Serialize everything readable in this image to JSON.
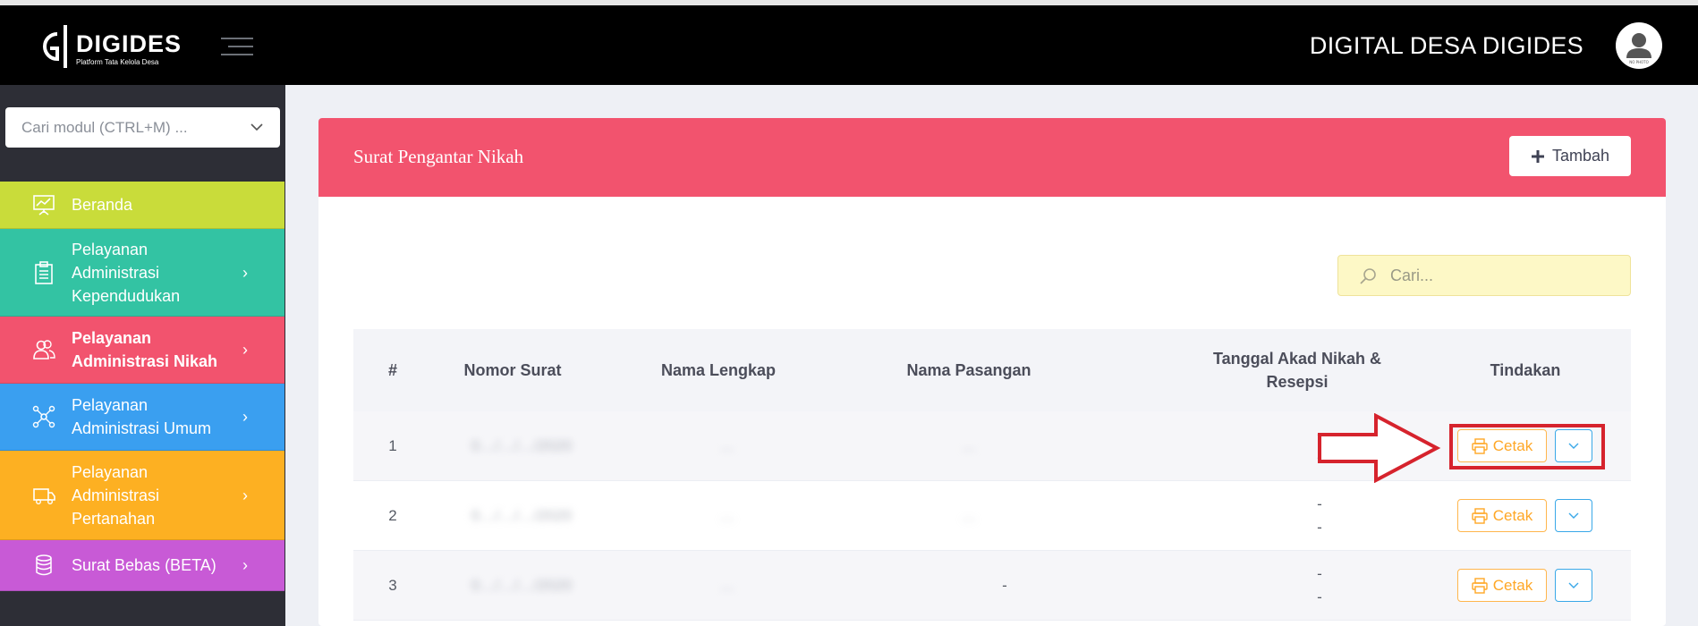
{
  "header": {
    "logo_name": "DIGIDES",
    "logo_tagline": "Platform Tata Kelola Desa",
    "app_title": "DIGITAL DESA DIGIDES",
    "avatar_text": "NO PHOTO"
  },
  "sidebar": {
    "module_search_placeholder": "Cari modul (CTRL+M) ...",
    "items": [
      {
        "label_lines": [
          "Beranda"
        ],
        "icon": "chart-presentation-icon",
        "color": "#c9dc3a",
        "has_arrow": false
      },
      {
        "label_lines": [
          "Pelayanan",
          "Administrasi",
          "Kependudukan"
        ],
        "icon": "clipboard-list-icon",
        "color": "#33c3a3",
        "has_arrow": true
      },
      {
        "label_lines": [
          "Pelayanan",
          "Administrasi Nikah"
        ],
        "icon": "users-icon",
        "color": "#f2536e",
        "has_arrow": true,
        "active": true
      },
      {
        "label_lines": [
          "Pelayanan",
          "Administrasi Umum"
        ],
        "icon": "network-icon",
        "color": "#3a9ff0",
        "has_arrow": true
      },
      {
        "label_lines": [
          "Pelayanan",
          "Administrasi",
          "Pertanahan"
        ],
        "icon": "truck-icon",
        "color": "#fdb022",
        "has_arrow": true
      },
      {
        "label_lines": [
          "Surat Bebas (BETA)"
        ],
        "icon": "coins-stack-icon",
        "color": "#c85ad6",
        "has_arrow": true
      }
    ],
    "arrow_glyph": "›"
  },
  "card": {
    "title": "Surat Pengantar Nikah",
    "add_button": "Tambah",
    "search_placeholder": "Cari..."
  },
  "table": {
    "headers": [
      "#",
      "Nomor Surat",
      "Nama Lengkap",
      "Nama Pasangan",
      "Tanggal Akad Nikah & Resepsi",
      "Tindakan"
    ],
    "rows": [
      {
        "no": "1",
        "nomor_surat": "0…/…/…/2020",
        "nama_lengkap": "…",
        "nama_pasangan": "…",
        "akad": "-",
        "resepsi": "-"
      },
      {
        "no": "2",
        "nomor_surat": "0…/…/…/2020",
        "nama_lengkap": "…",
        "nama_pasangan": "…",
        "akad": "-",
        "resepsi": "-"
      },
      {
        "no": "3",
        "nomor_surat": "0…/…/…/2020",
        "nama_lengkap": "…",
        "nama_pasangan": "-",
        "akad": "-",
        "resepsi": "-"
      }
    ],
    "action_label": "Cetak"
  },
  "colors": {
    "topbar": "#000000",
    "sidebar": "#2d2e36",
    "card_header": "#f2536e",
    "search_bg": "#fdf8c6",
    "cetak": "#ffa726",
    "dropdown_border": "#39a8e8",
    "annotation": "#d6232d"
  }
}
